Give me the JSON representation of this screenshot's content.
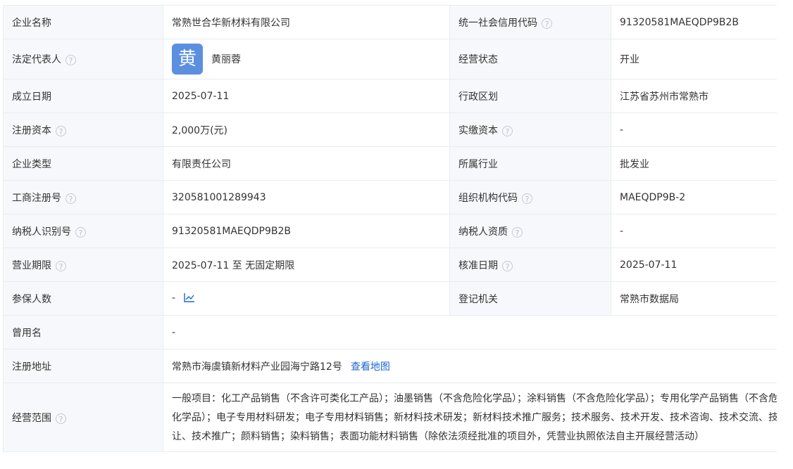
{
  "fields": {
    "company_name": {
      "label": "企业名称",
      "value": "常熟世合华新材料有限公司"
    },
    "credit_code": {
      "label": "统一社会信用代码",
      "value": "91320581MAEQDP9B2B"
    },
    "legal_rep": {
      "label": "法定代表人",
      "avatar_char": "黄",
      "value": "黄丽蓉"
    },
    "status": {
      "label": "经营状态",
      "value": "开业"
    },
    "established": {
      "label": "成立日期",
      "value": "2025-07-11"
    },
    "region": {
      "label": "行政区划",
      "value": "江苏省苏州市常熟市"
    },
    "reg_capital": {
      "label": "注册资本",
      "value": "2,000万(元)"
    },
    "paid_capital": {
      "label": "实缴资本",
      "value": "-"
    },
    "company_type": {
      "label": "企业类型",
      "value": "有限责任公司"
    },
    "industry": {
      "label": "所属行业",
      "value": "批发业"
    },
    "reg_number": {
      "label": "工商注册号",
      "value": "320581001289943"
    },
    "org_code": {
      "label": "组织机构代码",
      "value": "MAEQDP9B-2"
    },
    "taxpayer_id": {
      "label": "纳税人识别号",
      "value": "91320581MAEQDP9B2B"
    },
    "taxpayer_qual": {
      "label": "纳税人资质",
      "value": "-"
    },
    "term": {
      "label": "营业期限",
      "value": "2025-07-11 至 无固定期限"
    },
    "approval_date": {
      "label": "核准日期",
      "value": "2025-07-11"
    },
    "insured": {
      "label": "参保人数",
      "value": "-"
    },
    "authority": {
      "label": "登记机关",
      "value": "常熟市数据局"
    },
    "former_name": {
      "label": "曾用名",
      "value": "-"
    },
    "address": {
      "label": "注册地址",
      "value": "常熟市海虞镇新材料产业园海宁路12号",
      "link": "查看地图"
    },
    "scope": {
      "label": "经营范围",
      "lines": [
        "一般项目：化工产品销售（不含许可类化工产品）；油墨销售（不含危险化学品）；涂料销售（不含危险化学品）；专用化学产品销售（不含危险",
        "化学品）；电子专用材料研发；电子专用材料销售；新材料技术研发；新材料技术推广服务；技术服务、技术开发、技术咨询、技术交流、技术转",
        "让、技术推广；颜料销售；染料销售；表面功能材料销售（除依法须经批准的项目外，凭营业执照依法自主开展经营活动）"
      ]
    }
  },
  "help_glyph": "?",
  "icons": {
    "help": "help-circle-icon",
    "trend": "trend-chart-icon"
  },
  "colors": {
    "label_bg": "#f6f8fb",
    "border": "#e8edf3",
    "link": "#1b66d2",
    "avatar_bg": "#5b8fe0"
  }
}
